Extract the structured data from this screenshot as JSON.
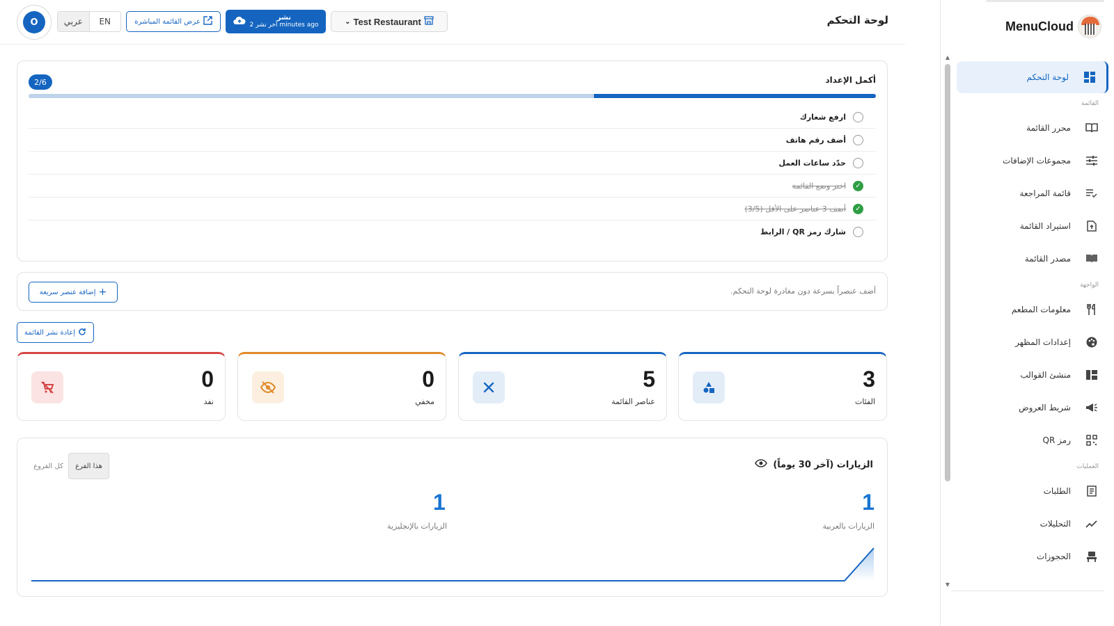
{
  "sidebar": {
    "brand": "MenuCloud",
    "items": [
      {
        "label": "لوحة التحكم",
        "icon": "dashboard-icon",
        "active": true
      },
      {
        "section": "القائمة"
      },
      {
        "label": "محرر القائمة",
        "icon": "book-icon"
      },
      {
        "label": "مجموعات الإضافات",
        "icon": "sliders-icon"
      },
      {
        "label": "قائمة المراجعة",
        "icon": "checklist-icon"
      },
      {
        "label": "استيراد القائمة",
        "icon": "file-upload-icon"
      },
      {
        "label": "مصدر القائمة",
        "icon": "book-open-icon"
      },
      {
        "section": "الواجهة"
      },
      {
        "label": "معلومات المطعم",
        "icon": "restaurant-icon"
      },
      {
        "label": "إعدادات المظهر",
        "icon": "palette-icon"
      },
      {
        "label": "منشئ القوالب",
        "icon": "template-icon"
      },
      {
        "label": "شريط العروض",
        "icon": "megaphone-icon"
      },
      {
        "label": "رمز QR",
        "icon": "qr-code-icon"
      },
      {
        "section": "العمليات"
      },
      {
        "label": "الطلبات",
        "icon": "receipt-icon"
      },
      {
        "label": "التحليلات",
        "icon": "analytics-icon"
      },
      {
        "label": "الحجوزات",
        "icon": "chair-icon"
      }
    ]
  },
  "header": {
    "title": "لوحة التحكم",
    "avatar_letter": "O",
    "lang_ar": "عربي",
    "lang_en": "EN",
    "view_menu_label": "عرض القائمة المباشرة",
    "publish_label": "نشر",
    "publish_sub": "آخر نشر 2 minutes ago",
    "restaurant_name": "Test Restaurant"
  },
  "setup": {
    "title": "أكمل الإعداد",
    "progress_label": "2/6",
    "progress": 0.333,
    "items": [
      {
        "label": "ارفع شعارك",
        "done": false
      },
      {
        "label": "أضف رقم هاتف",
        "done": false
      },
      {
        "label": "حدّد ساعات العمل",
        "done": false
      },
      {
        "label": "اختر وضع القائمة",
        "done": true
      },
      {
        "label": "أضف 3 عناصر على الأقل (3/5)",
        "done": true
      },
      {
        "label": "شارك رمز QR / الرابط",
        "done": false
      }
    ]
  },
  "quick_add": {
    "hint": "أضف عنصراً بسرعة دون مغادرة لوحة التحكم.",
    "button_label": "إضافة عنصر سريعة"
  },
  "republish_label": "إعادة نشر القائمة",
  "stats": [
    {
      "value": "3",
      "label": "الفئات",
      "color": "#1565c0",
      "icon": "shapes-icon"
    },
    {
      "value": "5",
      "label": "عناصر القائمة",
      "color": "#1565c0",
      "icon": "utensils-icon"
    },
    {
      "value": "0",
      "label": "مخفي",
      "color": "#e08a2a",
      "icon": "eye-off-icon"
    },
    {
      "value": "0",
      "label": "نفد",
      "color": "#d64545",
      "icon": "cart-off-icon"
    }
  ],
  "visits": {
    "title": "الزيارات (آخر 30 يوماً)",
    "seg_this": "هذا الفرع",
    "seg_all": "كل الفروع",
    "arabic_value": "1",
    "arabic_label": "الزيارات بالعربية",
    "english_value": "1",
    "english_label": "الزيارات بالإنجليزية",
    "accent": "#1976d2"
  }
}
